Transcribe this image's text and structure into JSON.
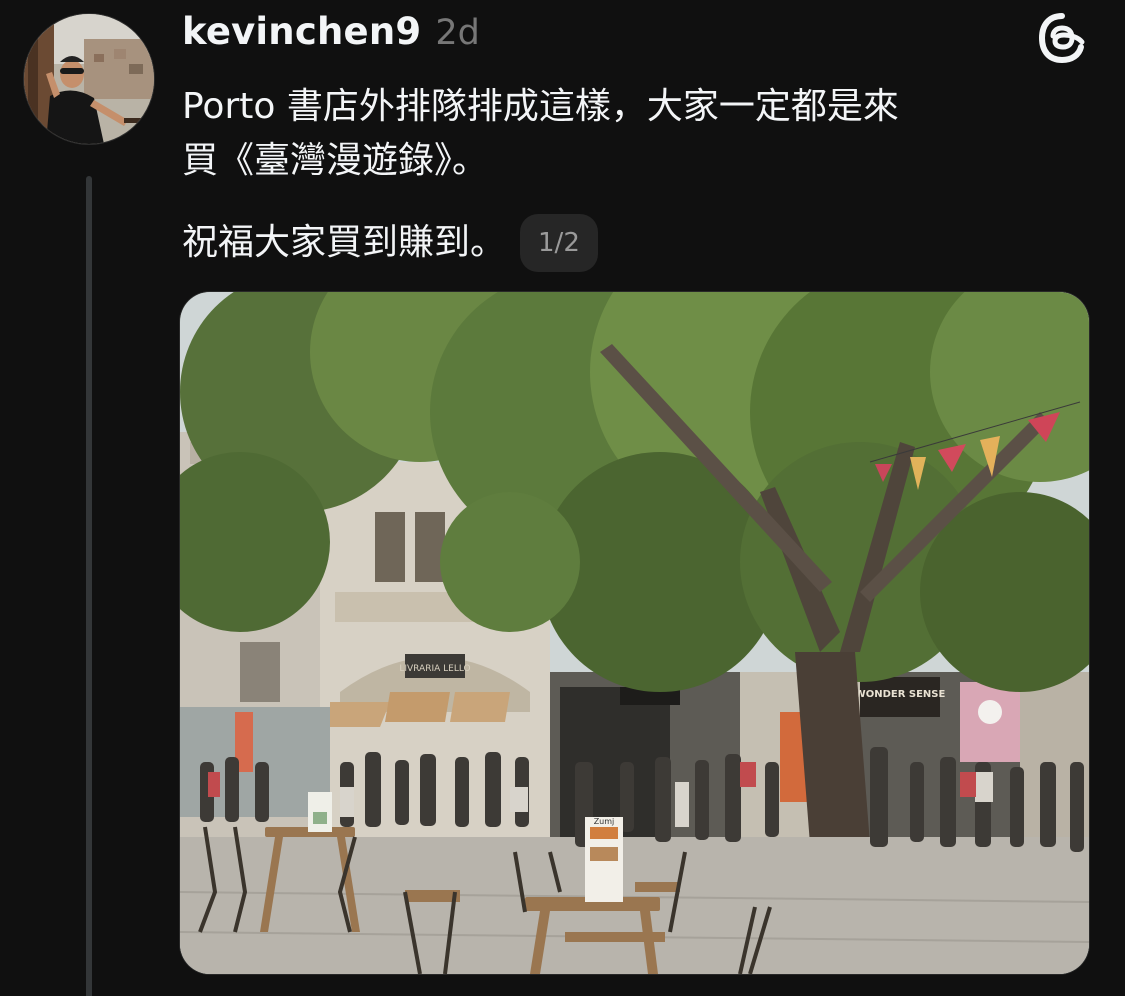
{
  "post": {
    "username": "kevinchen9",
    "timestamp": "2d",
    "paragraph1_line1": "Porto 書店外排隊排成這樣，大家一定都是來",
    "paragraph1_line2": "買《臺灣漫遊錄》。",
    "paragraph2": "祝福大家買到賺到。",
    "image_counter": "1/2"
  },
  "photo": {
    "shop_sign_1": "LIVRARIA LELLO",
    "shop_sign_2": "WONDER SENSE",
    "menu_board": "Zumj"
  },
  "icons": {
    "app_logo": "threads-logo-icon"
  },
  "colors": {
    "background": "#101010",
    "text_primary": "#f3f5f7",
    "text_secondary": "#777777",
    "thread_line": "#333638",
    "counter_bg": "#262626"
  }
}
